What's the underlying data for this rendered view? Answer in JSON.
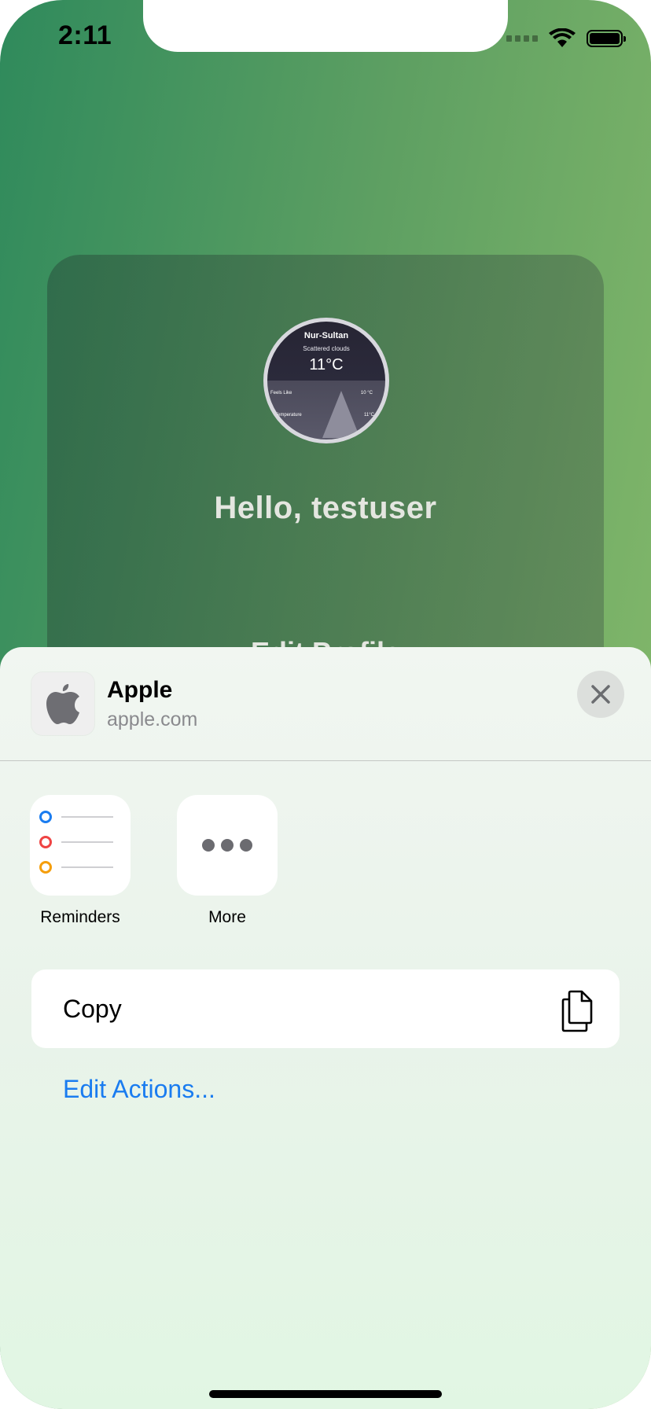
{
  "status_bar": {
    "time": "2:11"
  },
  "profile": {
    "weather": {
      "city": "Nur-Sultan",
      "description": "Scattered clouds",
      "temperature": "11°C",
      "feels_like_label": "Feels Like",
      "feels_like_value": "10 °C",
      "temperature_label": "Temperature",
      "temperature_value": "11°C"
    },
    "greeting": "Hello, testuser",
    "edit_profile_label": "Edit Profile"
  },
  "share_sheet": {
    "title": "Apple",
    "subtitle": "apple.com",
    "apps": [
      {
        "label": "Reminders",
        "icon": "reminders-icon"
      },
      {
        "label": "More",
        "icon": "more-icon"
      }
    ],
    "actions": [
      {
        "label": "Copy",
        "icon": "copy-icon"
      }
    ],
    "edit_actions_label": "Edit Actions...",
    "colors": {
      "link": "#1a7cf0",
      "reminder_blue": "#1a7cf0",
      "reminder_red": "#ef4444",
      "reminder_orange": "#f59e0b"
    }
  }
}
